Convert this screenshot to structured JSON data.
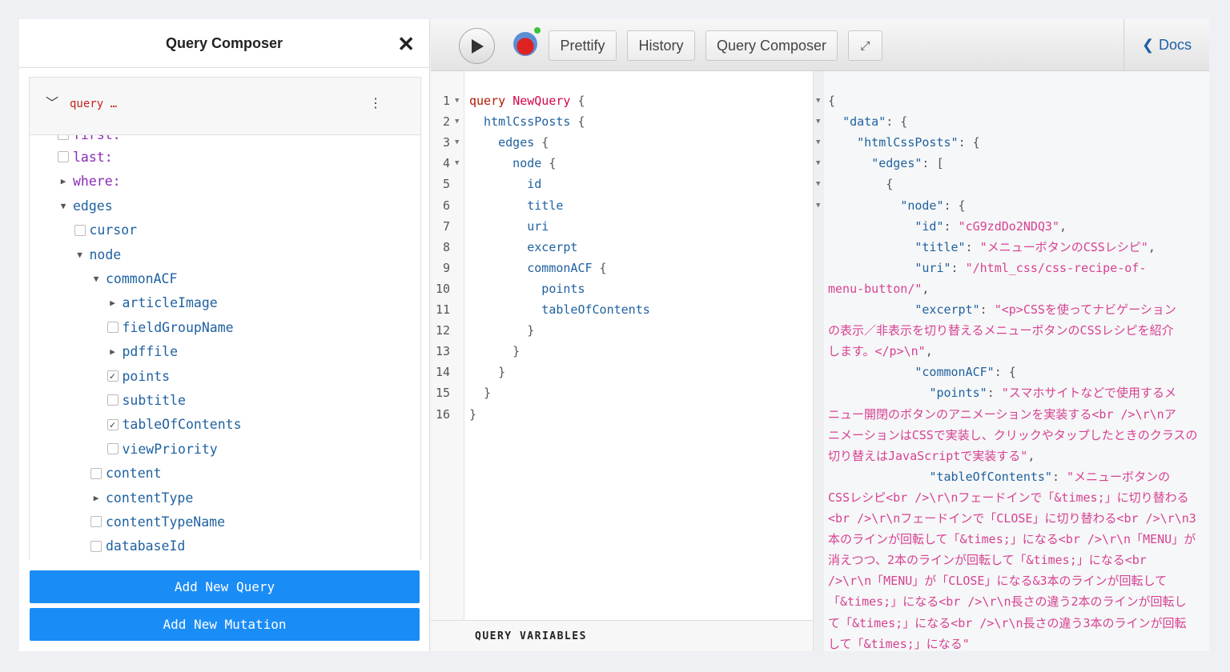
{
  "explorer": {
    "title": "Query Composer",
    "close_icon": "close-icon",
    "query_label": "query …",
    "tree": [
      {
        "label": "first:",
        "kind": "arg",
        "ctl": "cb",
        "checked": false,
        "depth": 0,
        "partial": true
      },
      {
        "label": "last:",
        "kind": "arg",
        "ctl": "cb",
        "checked": false,
        "depth": 0
      },
      {
        "label": "where:",
        "kind": "arg",
        "ctl": "arrow",
        "open": false,
        "depth": 0
      },
      {
        "label": "edges",
        "kind": "fld",
        "ctl": "arrow",
        "open": true,
        "depth": 0
      },
      {
        "label": "cursor",
        "kind": "fld",
        "ctl": "cb",
        "checked": false,
        "depth": 1
      },
      {
        "label": "node",
        "kind": "fld",
        "ctl": "arrow",
        "open": true,
        "depth": 1
      },
      {
        "label": "commonACF",
        "kind": "fld",
        "ctl": "arrow",
        "open": true,
        "depth": 2
      },
      {
        "label": "articleImage",
        "kind": "fld",
        "ctl": "arrow",
        "open": false,
        "depth": 3
      },
      {
        "label": "fieldGroupName",
        "kind": "fld",
        "ctl": "cb",
        "checked": false,
        "depth": 3
      },
      {
        "label": "pdffile",
        "kind": "fld",
        "ctl": "arrow",
        "open": false,
        "depth": 3
      },
      {
        "label": "points",
        "kind": "fld",
        "ctl": "cb",
        "checked": true,
        "depth": 3
      },
      {
        "label": "subtitle",
        "kind": "fld",
        "ctl": "cb",
        "checked": false,
        "depth": 3
      },
      {
        "label": "tableOfContents",
        "kind": "fld",
        "ctl": "cb",
        "checked": true,
        "depth": 3
      },
      {
        "label": "viewPriority",
        "kind": "fld",
        "ctl": "cb",
        "checked": false,
        "depth": 3
      },
      {
        "label": "content",
        "kind": "fld",
        "ctl": "cb",
        "checked": false,
        "depth": 2
      },
      {
        "label": "contentType",
        "kind": "fld",
        "ctl": "arrow",
        "open": false,
        "depth": 2
      },
      {
        "label": "contentTypeName",
        "kind": "fld",
        "ctl": "cb",
        "checked": false,
        "depth": 2
      },
      {
        "label": "databaseId",
        "kind": "fld",
        "ctl": "cb",
        "checked": false,
        "depth": 2
      }
    ],
    "add_query": "Add New Query",
    "add_mutation": "Add New Mutation"
  },
  "toolbar": {
    "prettify": "Prettify",
    "history": "History",
    "composer": "Query Composer",
    "docs": "Docs"
  },
  "editor": {
    "lines": [
      [
        [
          "kw",
          "query "
        ],
        [
          "def",
          "NewQuery"
        ],
        [
          "p",
          " {"
        ]
      ],
      [
        [
          "f",
          "  htmlCssPosts"
        ],
        [
          "p",
          " {"
        ]
      ],
      [
        [
          "f",
          "    edges"
        ],
        [
          "p",
          " {"
        ]
      ],
      [
        [
          "f",
          "      node"
        ],
        [
          "p",
          " {"
        ]
      ],
      [
        [
          "f",
          "        id"
        ]
      ],
      [
        [
          "f",
          "        title"
        ]
      ],
      [
        [
          "f",
          "        uri"
        ]
      ],
      [
        [
          "f",
          "        excerpt"
        ]
      ],
      [
        [
          "f",
          "        commonACF"
        ],
        [
          "p",
          " {"
        ]
      ],
      [
        [
          "f",
          "          points"
        ]
      ],
      [
        [
          "f",
          "          tableOfContents"
        ]
      ],
      [
        [
          "p",
          "        }"
        ]
      ],
      [
        [
          "p",
          "      }"
        ]
      ],
      [
        [
          "p",
          "    }"
        ]
      ],
      [
        [
          "p",
          "  }"
        ]
      ],
      [
        [
          "p",
          "}"
        ]
      ]
    ],
    "folds": [
      1,
      2,
      3,
      4
    ],
    "variables_label": "QUERY VARIABLES"
  },
  "result": {
    "lines": [
      [
        [
          "p",
          "{"
        ]
      ],
      [
        [
          "p",
          "  "
        ],
        [
          "rk",
          "\"data\""
        ],
        [
          "p",
          ": {"
        ]
      ],
      [
        [
          "p",
          "    "
        ],
        [
          "rk",
          "\"htmlCssPosts\""
        ],
        [
          "p",
          ": {"
        ]
      ],
      [
        [
          "p",
          "      "
        ],
        [
          "rk",
          "\"edges\""
        ],
        [
          "p",
          ": ["
        ]
      ],
      [
        [
          "p",
          "        {"
        ]
      ],
      [
        [
          "p",
          "          "
        ],
        [
          "rk",
          "\"node\""
        ],
        [
          "p",
          ": {"
        ]
      ],
      [
        [
          "p",
          "            "
        ],
        [
          "rk",
          "\"id\""
        ],
        [
          "p",
          ": "
        ],
        [
          "rs",
          "\"cG9zdDo2NDQ3\""
        ],
        [
          "p",
          ","
        ]
      ],
      [
        [
          "p",
          "            "
        ],
        [
          "rk",
          "\"title\""
        ],
        [
          "p",
          ": "
        ],
        [
          "rs",
          "\"メニューボタンのCSSレシピ\""
        ],
        [
          "p",
          ","
        ]
      ],
      [
        [
          "p",
          "            "
        ],
        [
          "rk",
          "\"uri\""
        ],
        [
          "p",
          ": "
        ],
        [
          "rs",
          "\"/html_css/css-recipe-of-"
        ]
      ],
      [
        [
          "rs",
          "menu-button/\""
        ],
        [
          "p",
          ","
        ]
      ],
      [
        [
          "p",
          "            "
        ],
        [
          "rk",
          "\"excerpt\""
        ],
        [
          "p",
          ": "
        ],
        [
          "rs",
          "\"<p>CSSを使ってナビゲーション"
        ]
      ],
      [
        [
          "rs",
          "の表示／非表示を切り替えるメニューボタンのCSSレシピを紹介"
        ]
      ],
      [
        [
          "rs",
          "します。</p>\\n\""
        ],
        [
          "p",
          ","
        ]
      ],
      [
        [
          "p",
          "            "
        ],
        [
          "rk",
          "\"commonACF\""
        ],
        [
          "p",
          ": {"
        ]
      ],
      [
        [
          "p",
          "              "
        ],
        [
          "rk",
          "\"points\""
        ],
        [
          "p",
          ": "
        ],
        [
          "rs",
          "\"スマホサイトなどで使用するメ"
        ]
      ],
      [
        [
          "rs",
          "ニュー開閉のボタンのアニメーションを実装する<br />\\r\\nア"
        ]
      ],
      [
        [
          "rs",
          "ニメーションはCSSで実装し、クリックやタップしたときのクラスの"
        ]
      ],
      [
        [
          "rs",
          "切り替えはJavaScriptで実装する\""
        ],
        [
          "p",
          ","
        ]
      ],
      [
        [
          "p",
          "              "
        ],
        [
          "rk",
          "\"tableOfContents\""
        ],
        [
          "p",
          ": "
        ],
        [
          "rs",
          "\"メニューボタンの"
        ]
      ],
      [
        [
          "rs",
          "CSSレシピ<br />\\r\\nフェードインで「&times;」に切り替わる"
        ]
      ],
      [
        [
          "rs",
          "<br />\\r\\nフェードインで「CLOSE」に切り替わる<br />\\r\\n3"
        ]
      ],
      [
        [
          "rs",
          "本のラインが回転して「&times;」になる<br />\\r\\n「MENU」が"
        ]
      ],
      [
        [
          "rs",
          "消えつつ、2本のラインが回転して「&times;」になる<br"
        ]
      ],
      [
        [
          "rs",
          "/>\\r\\n「MENU」が「CLOSE」になる&3本のラインが回転して"
        ]
      ],
      [
        [
          "rs",
          "「&times;」になる<br />\\r\\n長さの違う2本のラインが回転し"
        ]
      ],
      [
        [
          "rs",
          "て「&times;」になる<br />\\r\\n長さの違う3本のラインが回転"
        ]
      ],
      [
        [
          "rs",
          "して「&times;」になる\""
        ]
      ]
    ],
    "folds": [
      0,
      1,
      2,
      3,
      4,
      5
    ]
  },
  "colors": {
    "accent": "#1a8cf6",
    "docs": "#1e5fa8",
    "keyword": "#b11a04",
    "string": "#d64292",
    "field": "#1f61a0"
  }
}
